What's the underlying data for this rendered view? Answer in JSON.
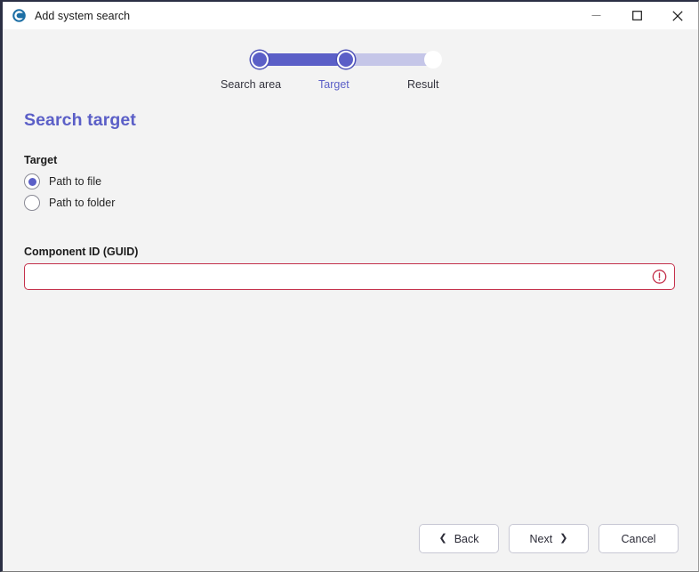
{
  "window": {
    "title": "Add system search",
    "app_icon": "app-logo-icon",
    "controls": {
      "minimize": "minimize-icon",
      "maximize": "maximize-icon",
      "close": "close-icon"
    },
    "accent_frame_color": "#2b2f44",
    "background_color": "#f3f3f3"
  },
  "stepper": {
    "accent_color": "#5b5fc7",
    "track_color": "#c5c6e8",
    "steps": [
      {
        "label": "Search area",
        "state": "done"
      },
      {
        "label": "Target",
        "state": "current"
      },
      {
        "label": "Result",
        "state": "pending"
      }
    ]
  },
  "page": {
    "title": "Search target",
    "title_color": "#5b5fc7"
  },
  "form": {
    "target_group": {
      "label": "Target",
      "options": [
        {
          "label": "Path to file",
          "selected": true
        },
        {
          "label": "Path to folder",
          "selected": false
        }
      ]
    },
    "component_id": {
      "label": "Component ID (GUID)",
      "value": "",
      "placeholder": "",
      "state": "error",
      "error_color": "#c4314b",
      "error_icon": "error-exclamation-icon"
    }
  },
  "footer": {
    "back_label": "Back",
    "back_chevron": "❮",
    "next_label": "Next",
    "next_chevron": "❯",
    "cancel_label": "Cancel"
  }
}
